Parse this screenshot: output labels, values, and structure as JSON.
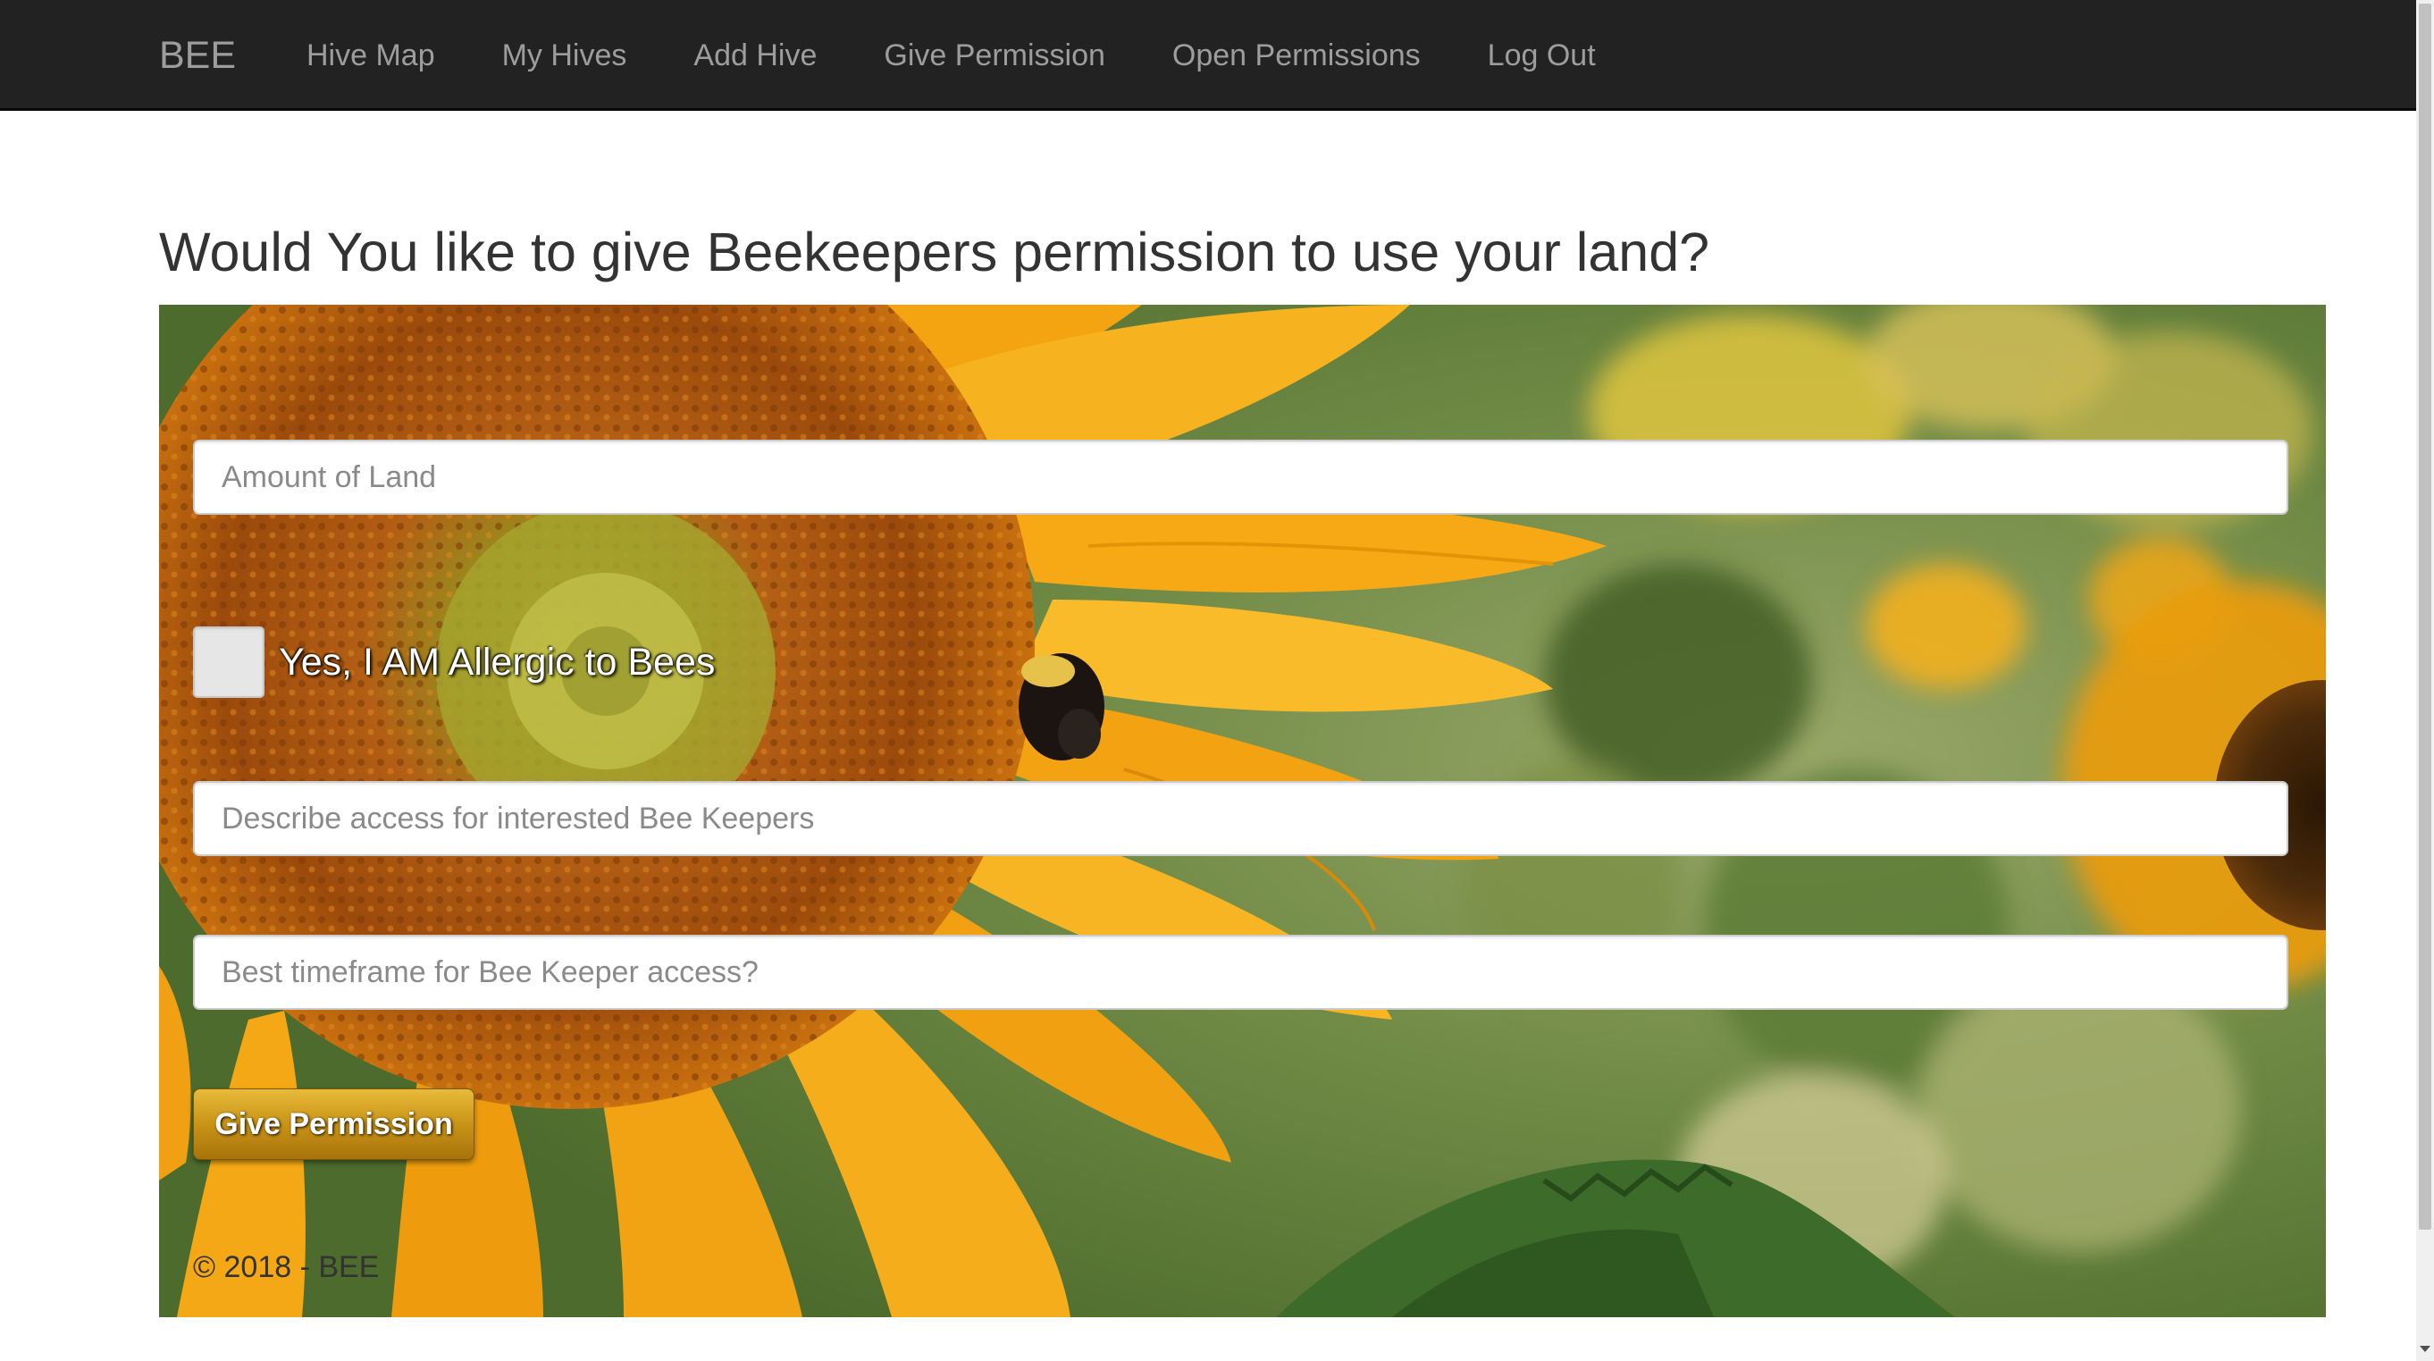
{
  "nav": {
    "brand": "BEE",
    "links": [
      {
        "label": "Hive Map"
      },
      {
        "label": "My Hives"
      },
      {
        "label": "Add Hive"
      },
      {
        "label": "Give Permission"
      },
      {
        "label": "Open Permissions"
      },
      {
        "label": "Log Out"
      }
    ]
  },
  "page": {
    "title": "Would You like to give Beekeepers permission to use your land?"
  },
  "form": {
    "land_placeholder": "Amount of Land",
    "allergic_label": "Yes, I AM Allergic to Bees",
    "allergic_checked": false,
    "access_placeholder": "Describe access for interested Bee Keepers",
    "timeframe_placeholder": "Best timeframe for Bee Keeper access?",
    "submit_label": "Give Permission"
  },
  "footer": {
    "text": "© 2018 - BEE"
  },
  "colors": {
    "navbar": "#222222",
    "nav_text": "#9d9d9d",
    "button_gold": "#c99317",
    "heading": "#333333"
  }
}
